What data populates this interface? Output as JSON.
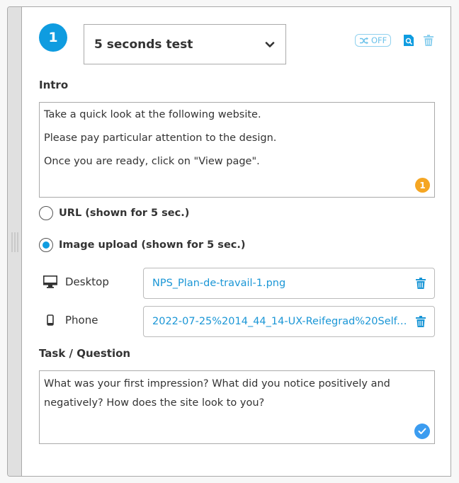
{
  "step": {
    "number": "1",
    "type_select": {
      "value": "5 seconds test"
    },
    "toolbar": {
      "shuffle_label": "OFF",
      "shuffle_state": "off"
    }
  },
  "intro": {
    "label": "Intro",
    "lines": [
      "Take a quick look at the following website.",
      "Please pay particular attention to the design.",
      "Once you are ready, click on \"View page\"."
    ],
    "notice_count": "1"
  },
  "source_options": [
    {
      "label": "URL (shown for 5 sec.)",
      "selected": false
    },
    {
      "label": "Image upload (shown for 5 sec.)",
      "selected": true
    }
  ],
  "uploads": [
    {
      "device": "Desktop",
      "icon": "desktop-monitor-icon",
      "file": "NPS_Plan-de-travail-1.png"
    },
    {
      "device": "Phone",
      "icon": "mobile-phone-icon",
      "file": "2022-07-25%2014_44_14-UX-Reifegrad%20Self-..."
    }
  ],
  "task": {
    "label": "Task / Question",
    "text": "What was your first impression? What did you notice positively and negatively? How does the site look to you?"
  },
  "colors": {
    "accent": "#0f9ce0",
    "link": "#1a96d6",
    "warning": "#f5a623",
    "success": "#3b9cf0",
    "toggle_off": "#6cc2ea"
  }
}
